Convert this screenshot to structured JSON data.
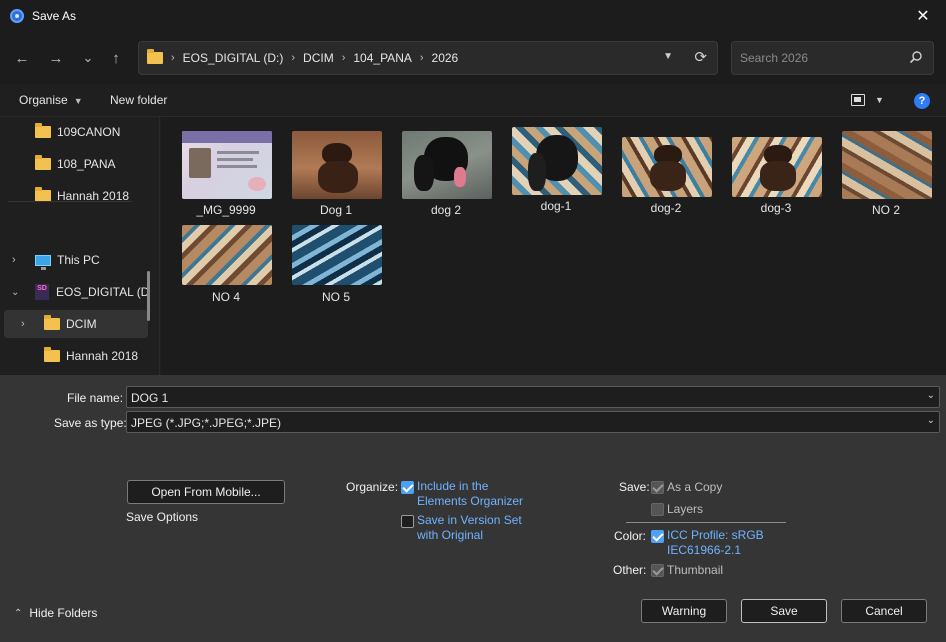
{
  "window": {
    "title": "Save As",
    "close": "✕"
  },
  "nav": {
    "back": "←",
    "forward": "→",
    "recent": "⌄",
    "up": "↑",
    "breadcrumb": [
      "EOS_DIGITAL (D:)",
      "DCIM",
      "104_PANA",
      "2026"
    ],
    "separator": "›",
    "search_placeholder": "Search 2026"
  },
  "toolbar": {
    "organise": "Organise",
    "new_folder": "New folder",
    "help": "?"
  },
  "navpane": {
    "items": [
      {
        "label": "109CANON",
        "icon": "folder-icon"
      },
      {
        "label": "108_PANA",
        "icon": "folder-icon"
      },
      {
        "label": "Hannah 2018",
        "icon": "folder-icon"
      },
      {
        "label": "This PC",
        "icon": "pc-icon"
      },
      {
        "label": "EOS_DIGITAL (D:)",
        "icon": "sd-card-icon"
      },
      {
        "label": "DCIM",
        "icon": "folder-icon",
        "selected": true
      },
      {
        "label": "Hannah 2018",
        "icon": "folder-icon"
      }
    ]
  },
  "files": [
    {
      "name": "_MG_9999",
      "thumb": "id-card"
    },
    {
      "name": "Dog 1",
      "thumb": "dog-brown"
    },
    {
      "name": "dog 2",
      "thumb": "dog-black"
    },
    {
      "name": "dog-1",
      "thumb": "dog-black-painted"
    },
    {
      "name": "dog-2",
      "thumb": "dog-brown-painted"
    },
    {
      "name": "dog-3",
      "thumb": "dog-brown-painted"
    },
    {
      "name": "NO 2",
      "thumb": "abstract-brown"
    },
    {
      "name": "NO 4",
      "thumb": "abstract-brown-blue"
    },
    {
      "name": "NO 5",
      "thumb": "abstract-blue"
    }
  ],
  "form": {
    "file_name_label": "File name:",
    "file_name_value": "DOG 1",
    "type_label": "Save as type:",
    "type_value": "JPEG (*.JPG;*.JPEG;*.JPE)"
  },
  "options": {
    "open_mobile": "Open From Mobile...",
    "save_options": "Save Options",
    "organize_label": "Organize:",
    "include_line1": "Include in the",
    "include_line2": "Elements Organizer",
    "version_line1": "Save in Version Set",
    "version_line2": "with Original",
    "save_label": "Save:",
    "as_copy": "As a Copy",
    "layers": "Layers",
    "color_label": "Color:",
    "icc_line1": "ICC Profile:  sRGB",
    "icc_line2": "IEC61966-2.1",
    "other_label": "Other:",
    "thumbnail": "Thumbnail"
  },
  "footer": {
    "hide_folders": "Hide Folders",
    "warning": "Warning",
    "save": "Save",
    "cancel": "Cancel"
  },
  "colors": {
    "accent": "#4ea1f3",
    "help": "#2f7cf6",
    "folder": "#f2c14e"
  }
}
